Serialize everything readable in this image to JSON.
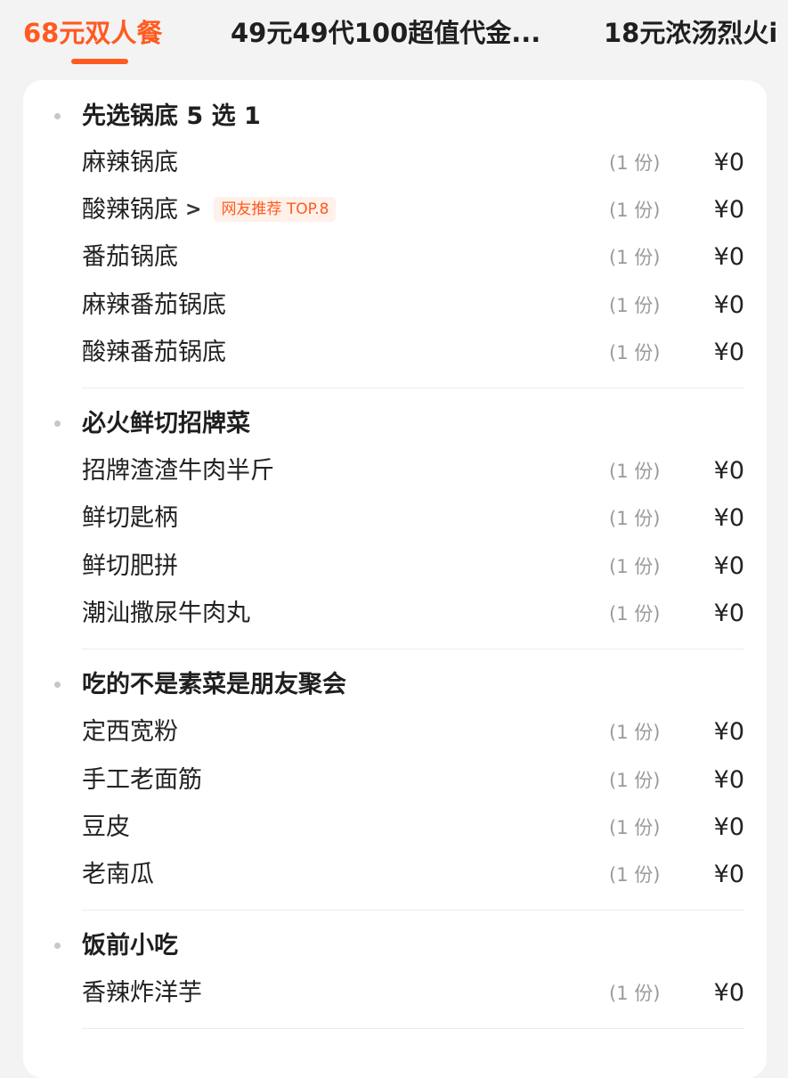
{
  "tabs": [
    {
      "label": "68元双人餐",
      "active": true
    },
    {
      "label": "49元49代100超值代金...",
      "active": false
    },
    {
      "label": "18元浓汤烈火i",
      "active": false
    }
  ],
  "groups": [
    {
      "title": "先选锅底 5 选 1",
      "items": [
        {
          "name": "麻辣锅底",
          "qty": "(1 份)",
          "price": "¥0"
        },
        {
          "name": "酸辣锅底",
          "qty": "(1 份)",
          "price": "¥0",
          "tag": "网友推荐 TOP.8"
        },
        {
          "name": "番茄锅底",
          "qty": "(1 份)",
          "price": "¥0"
        },
        {
          "name": "麻辣番茄锅底",
          "qty": "(1 份)",
          "price": "¥0"
        },
        {
          "name": "酸辣番茄锅底",
          "qty": "(1 份)",
          "price": "¥0"
        }
      ]
    },
    {
      "title": "必火鲜切招牌菜",
      "items": [
        {
          "name": "招牌渣渣牛肉半斤",
          "qty": "(1 份)",
          "price": "¥0"
        },
        {
          "name": "鲜切匙柄",
          "qty": "(1 份)",
          "price": "¥0"
        },
        {
          "name": "鲜切肥拼",
          "qty": "(1 份)",
          "price": "¥0"
        },
        {
          "name": "潮汕撒尿牛肉丸",
          "qty": "(1 份)",
          "price": "¥0"
        }
      ]
    },
    {
      "title": "吃的不是素菜是朋友聚会",
      "items": [
        {
          "name": "定西宽粉",
          "qty": "(1 份)",
          "price": "¥0"
        },
        {
          "name": "手工老面筋",
          "qty": "(1 份)",
          "price": "¥0"
        },
        {
          "name": "豆皮",
          "qty": "(1 份)",
          "price": "¥0"
        },
        {
          "name": "老南瓜",
          "qty": "(1 份)",
          "price": "¥0"
        }
      ]
    },
    {
      "title": "饭前小吃",
      "items": [
        {
          "name": "香辣炸洋芋",
          "qty": "(1 份)",
          "price": "¥0"
        }
      ]
    }
  ],
  "colors": {
    "accent": "#ff5a1f",
    "tag_bg": "#fff1ea",
    "muted": "#9a9a9a"
  },
  "icons": {
    "chevron": "chevron-right-icon"
  }
}
